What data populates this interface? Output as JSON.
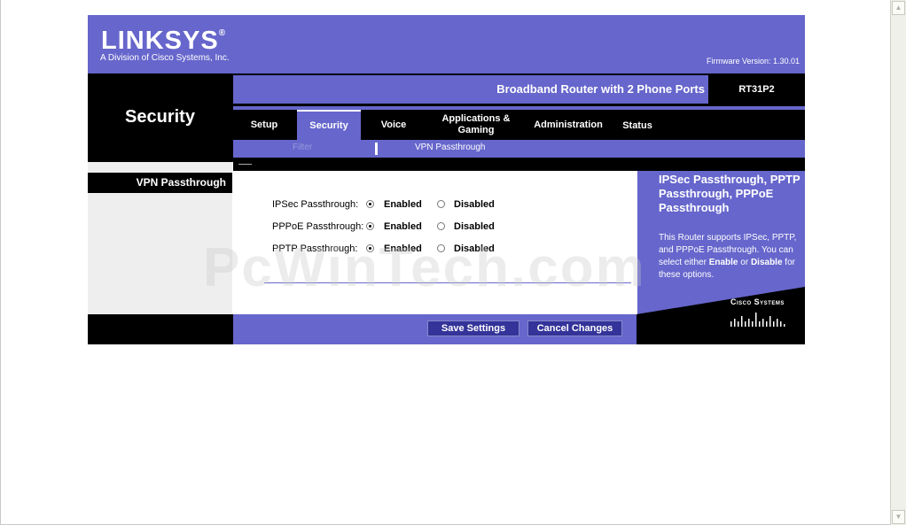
{
  "header": {
    "logo_text": "LINKSYS",
    "logo_reg": "®",
    "logo_sub": "A Division of Cisco Systems, Inc.",
    "firmware": "Firmware Version: 1.30.01"
  },
  "section_title": "Security",
  "product_name": "Broadband Router with 2 Phone Ports",
  "model": "RT31P2",
  "tabs": [
    {
      "label": "Setup"
    },
    {
      "label": "Security"
    },
    {
      "label": "Voice"
    },
    {
      "label": "Applications & Gaming"
    },
    {
      "label": "Administration"
    },
    {
      "label": "Status"
    }
  ],
  "subnav": {
    "filter": "Filter",
    "vpn": "VPN Passthrough"
  },
  "left_label": "VPN Passthrough",
  "settings": [
    {
      "label": "IPSec Passthrough:",
      "enabled": "Enabled",
      "disabled": "Disabled",
      "selected": "enabled"
    },
    {
      "label": "PPPoE Passthrough:",
      "enabled": "Enabled",
      "disabled": "Disabled",
      "selected": "enabled"
    },
    {
      "label": "PPTP Passthrough:",
      "enabled": "Enabled",
      "disabled": "Disabled",
      "selected": "enabled"
    }
  ],
  "help": {
    "title": "IPSec Passthrough, PPTP Passthrough, PPPoE Passthrough",
    "text_1": "This Router supports IPSec, PPTP, and PPPoE Passthrough. You can select either ",
    "enable": "Enable",
    "or": " or ",
    "disable": "Disable",
    "text_2": " for these options."
  },
  "cisco": "Cisco Systems",
  "buttons": {
    "save": "Save Settings",
    "cancel": "Cancel Changes"
  },
  "watermark": "PcWinTech.com",
  "colors": {
    "brand": "#6666cc",
    "dark": "#000000",
    "button": "#333399"
  }
}
